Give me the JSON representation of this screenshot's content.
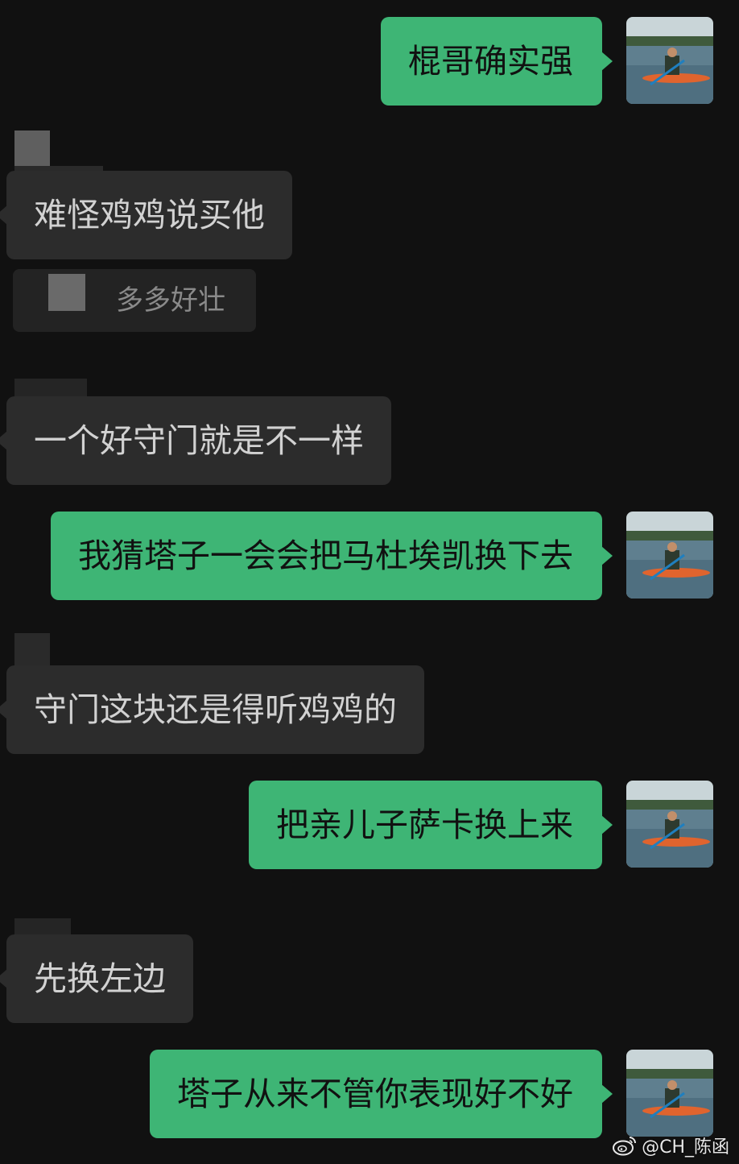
{
  "conversation": {
    "messages": [
      {
        "side": "out",
        "text": "棍哥确实强"
      },
      {
        "side": "in",
        "text": "难怪鸡鸡说买他"
      },
      {
        "side": "in",
        "text": "一个好守门就是不一样"
      },
      {
        "side": "out",
        "text": "我猜塔子一会会把马杜埃凯换下去"
      },
      {
        "side": "in",
        "text": "守门这块还是得听鸡鸡的"
      },
      {
        "side": "out",
        "text": "把亲儿子萨卡换上来"
      },
      {
        "side": "in",
        "text": "先换左边"
      },
      {
        "side": "out",
        "text": "塔子从来不管你表现好不好"
      }
    ],
    "reply_quote": {
      "text": "多多好壮"
    }
  },
  "watermark": {
    "text": "@CH_陈函"
  },
  "colors": {
    "background": "#111111",
    "outgoing_bubble": "#3eb575",
    "incoming_bubble": "#2c2c2c",
    "incoming_text": "#d2d2d2"
  },
  "icons": {
    "watermark_icon": "weibo-icon",
    "avatar": "kayak-photo-avatar"
  }
}
